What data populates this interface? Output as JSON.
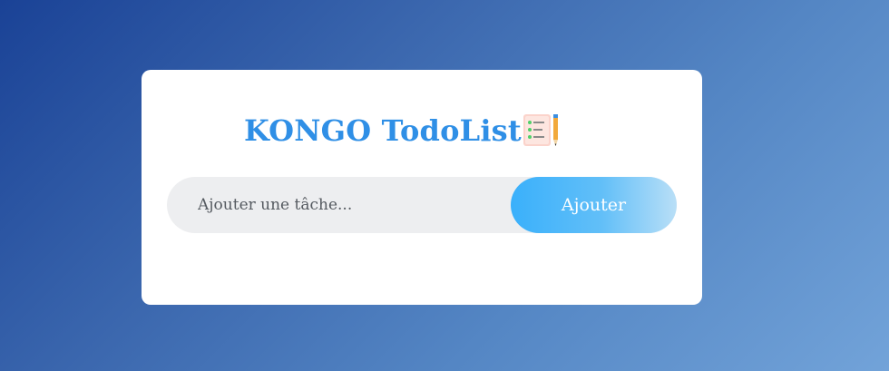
{
  "app": {
    "title": "KONGO TodoList",
    "emoji_icon": "todo-list-emoji-icon"
  },
  "form": {
    "input_value": "",
    "input_placeholder": "Ajouter une tâche...",
    "add_label": "Ajouter"
  },
  "colors": {
    "title": "#2f8fe6",
    "background_start": "#1a4296",
    "background_end": "#72a3d9",
    "button_start": "#3ab0fb",
    "button_end": "#b9dff7",
    "input_background": "#edeef0"
  }
}
